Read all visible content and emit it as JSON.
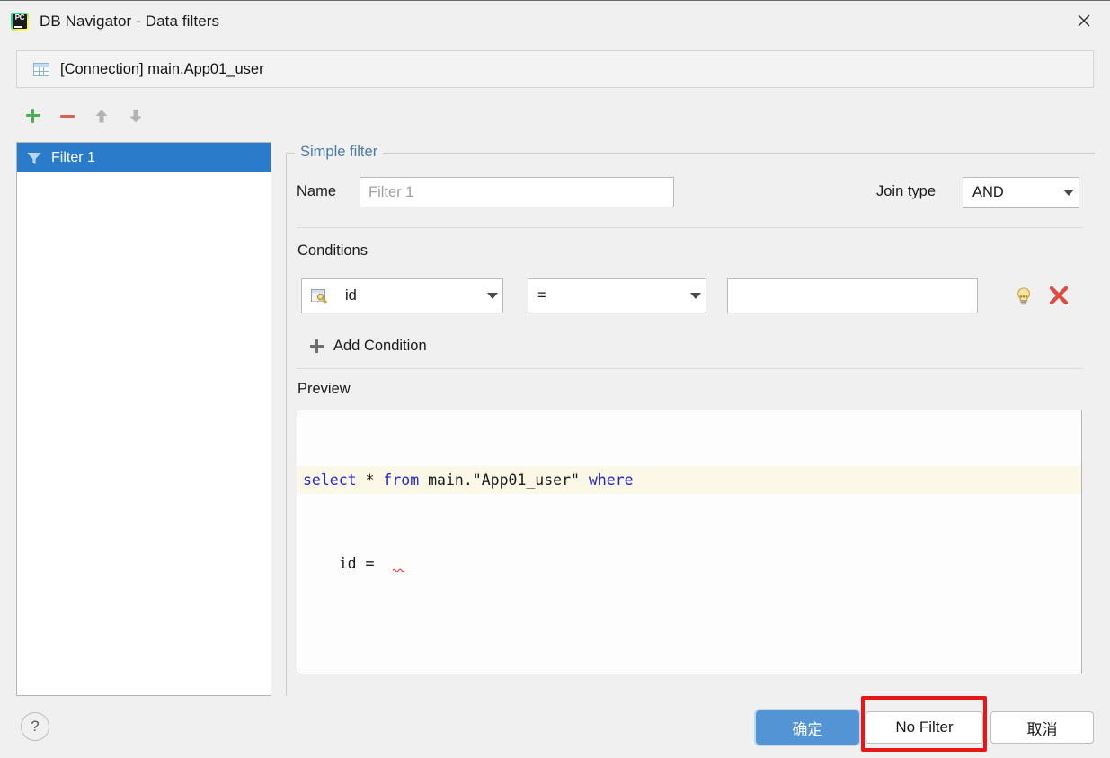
{
  "window": {
    "title": "DB Navigator - Data filters",
    "app_icon": "pycharm-icon",
    "icon_text": "PC",
    "close_icon": "close-icon"
  },
  "connection": {
    "icon": "table-icon",
    "label": "[Connection] main.App01_user"
  },
  "toolbar": {
    "add_icon": "plus-icon",
    "remove_icon": "minus-icon",
    "move_up_icon": "arrow-up-icon",
    "move_down_icon": "arrow-down-icon"
  },
  "filter_list": {
    "items": [
      {
        "label": "Filter 1",
        "icon": "funnel-icon",
        "selected": true
      }
    ]
  },
  "simple_filter": {
    "group_title": "Simple filter",
    "name_label": "Name",
    "name_value": "",
    "name_placeholder": "Filter 1",
    "join_type_label": "Join type",
    "join_type_value": "AND",
    "conditions_label": "Conditions",
    "condition": {
      "column_icon": "table-key-icon",
      "column_value": "id",
      "operator_value": "=",
      "value": "",
      "hint_icon": "lightbulb-icon",
      "remove_icon": "red-x-icon"
    },
    "add_condition_label": "Add Condition",
    "add_condition_icon": "plus-icon"
  },
  "preview": {
    "label": "Preview",
    "line1_kw1": "select",
    "line1_mid": " * ",
    "line1_kw2": "from",
    "line1_text": " main.\"App01_user\" ",
    "line1_kw3": "where",
    "line2_text": "    id ="
  },
  "footer": {
    "help_label": "?",
    "ok_label": "确定",
    "no_filter_label": "No Filter",
    "cancel_label": "取消"
  },
  "colors": {
    "accent_blue": "#2a7bc9",
    "ok_button": "#5394d4",
    "annotation_red": "#e81717",
    "group_title": "#4b7aa8",
    "sql_keyword": "#2525d0",
    "current_line": "#fbf8e8"
  }
}
